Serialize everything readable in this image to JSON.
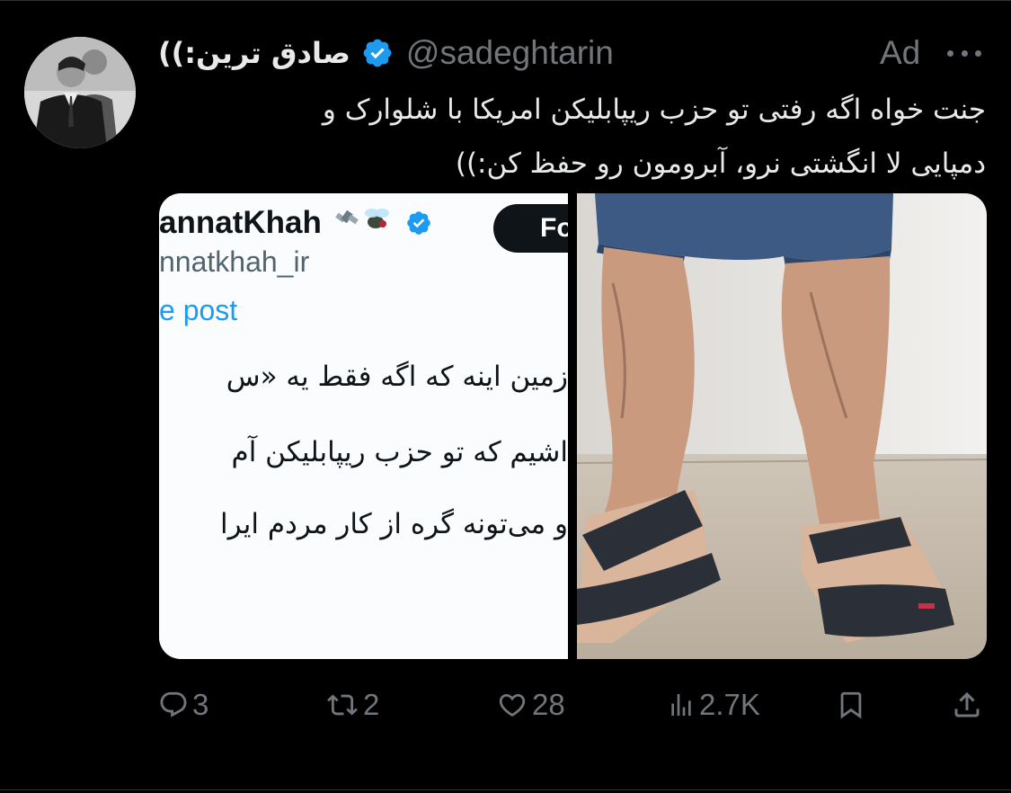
{
  "tweet": {
    "display_name": "صادق ترین:))",
    "handle": "@sadeghtarin",
    "ad_label": "Ad",
    "text_lines": [
      "جنت خواه اگه رفتی تو حزب ریپابلیکن امریکا با شلوارک و",
      "دمپایی لا انگشتی نرو، آبرومون رو حفظ کن:))"
    ]
  },
  "media": {
    "screenshot": {
      "name": "annatKhah",
      "handle": "nnatkhah_ir",
      "see_post": "e post",
      "follow": "Fo",
      "lines": [
        "زمین اینه که اگه فقط یه «س",
        "اشیم که تو حزب ریپابلیکن آم",
        "و می‌تونه گره از کار مردم ایرا"
      ]
    }
  },
  "actions": {
    "replies": "3",
    "reposts": "2",
    "likes": "28",
    "views": "2.7K"
  },
  "colors": {
    "background": "#000000",
    "text": "#e7e9ea",
    "muted": "#71767b",
    "verified": "#1d9bf0"
  },
  "icons": [
    "reply-icon",
    "repost-icon",
    "like-icon",
    "views-icon",
    "bookmark-icon",
    "share-icon",
    "verified-badge-icon",
    "more-icon"
  ]
}
